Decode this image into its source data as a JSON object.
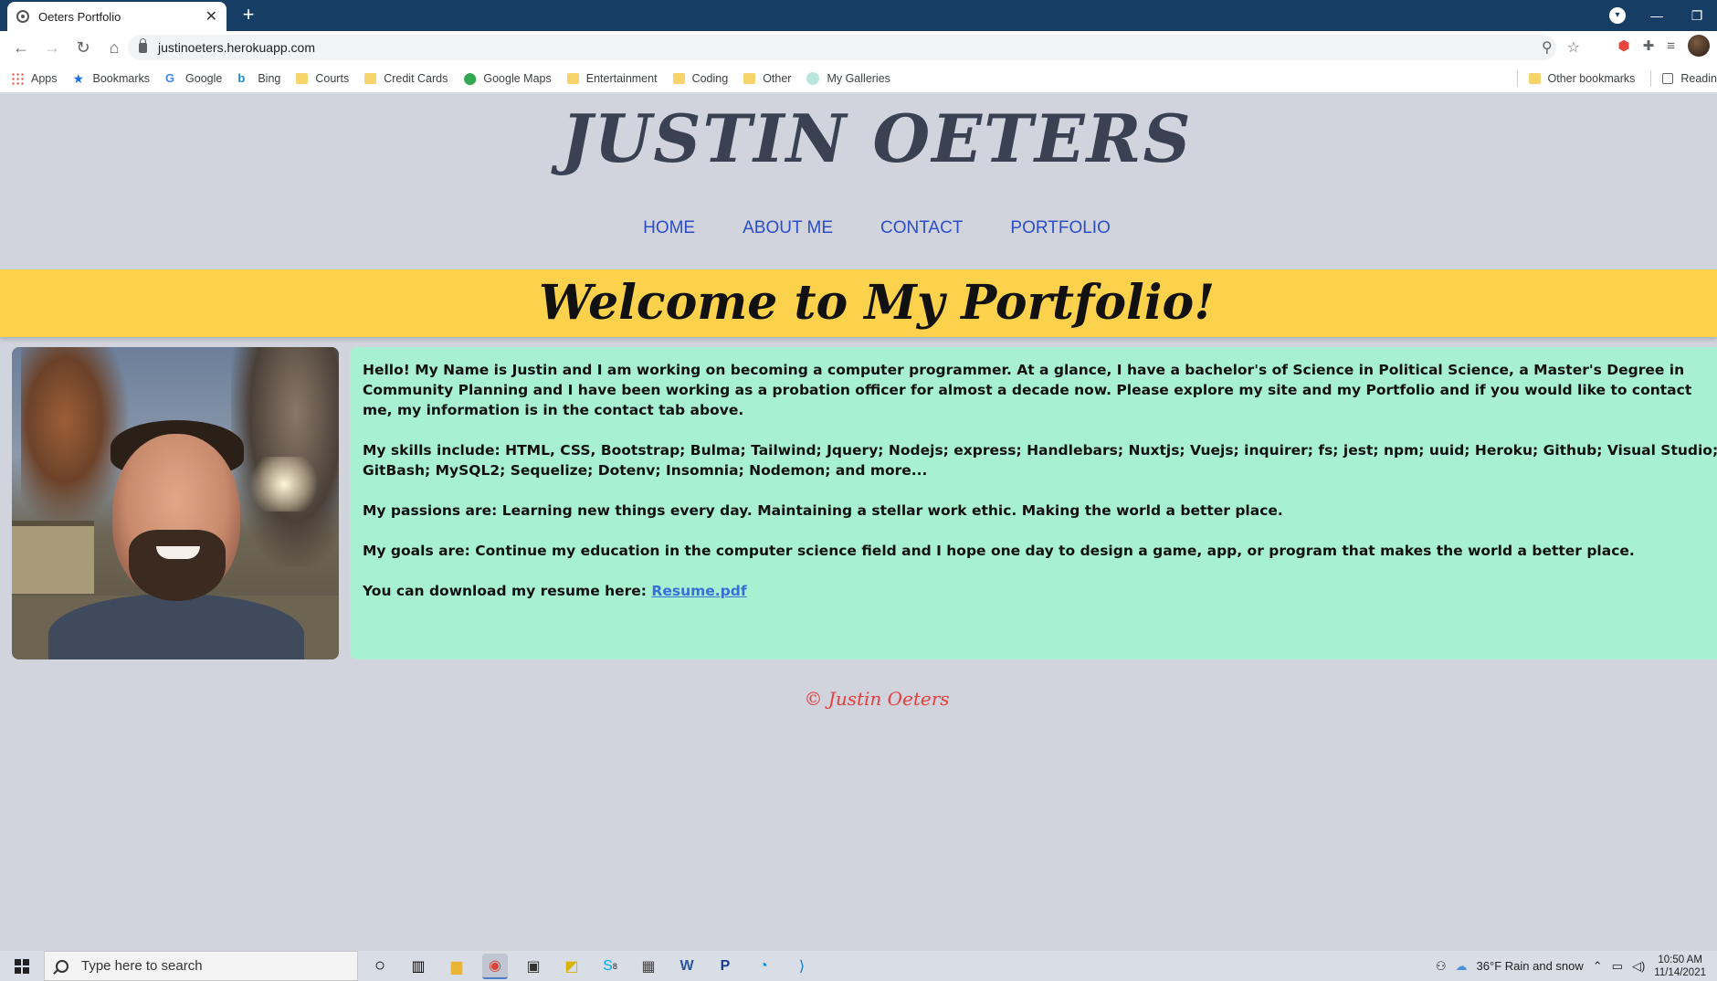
{
  "browser": {
    "tab_title": "Oeters Portfolio",
    "tab_close": "✕",
    "new_tab": "+",
    "url": "justinoeters.herokuapp.com"
  },
  "bookmarks": [
    {
      "label": "Apps",
      "icon": "apps-grid-icon"
    },
    {
      "label": "Bookmarks",
      "icon": "star-icon"
    },
    {
      "label": "Google",
      "icon": "google-icon"
    },
    {
      "label": "Bing",
      "icon": "bing-icon"
    },
    {
      "label": "Courts",
      "icon": "folder-icon"
    },
    {
      "label": "Credit Cards",
      "icon": "folder-icon"
    },
    {
      "label": "Google Maps",
      "icon": "maps-pin-icon"
    },
    {
      "label": "Entertainment",
      "icon": "folder-icon"
    },
    {
      "label": "Coding",
      "icon": "folder-icon"
    },
    {
      "label": "Other",
      "icon": "folder-icon"
    },
    {
      "label": "My Galleries",
      "icon": "galleries-icon"
    }
  ],
  "bookmarks_right": {
    "other": "Other bookmarks",
    "reading": "Readin"
  },
  "site": {
    "title": "JUSTIN OETERS",
    "nav": [
      "HOME",
      "ABOUT ME",
      "CONTACT",
      "PORTFOLIO"
    ],
    "welcome": "Welcome to My Portfolio!",
    "paragraphs": {
      "intro": "Hello! My Name is Justin and I am working on becoming a computer programmer. At a glance, I have a bachelor's of Science in Political Science, a Master's Degree in Community Planning and I have been working as a probation officer for almost a decade now. Please explore my site and my Portfolio and if you would like to contact me, my information is in the contact tab above.",
      "skills": "My skills include: HTML, CSS, Bootstrap; Bulma; Tailwind; Jquery; Nodejs; express; Handlebars; Nuxtjs; Vuejs; inquirer; fs; jest; npm; uuid; Heroku; Github; Visual Studio; GitBash; MySQL2; Sequelize; Dotenv; Insomnia; Nodemon; and more...",
      "passions": "My passions are: Learning new things every day. Maintaining a stellar work ethic. Making the world a better place.",
      "goals": "My goals are: Continue my education in the computer science field and I hope one day to design a game, app, or program that makes the world a better place.",
      "resume_prefix": "You can download my resume here: ",
      "resume_link": "Resume.pdf"
    },
    "footer": "© Justin Oeters"
  },
  "taskbar": {
    "search_placeholder": "Type here to search",
    "skype_badge": "8",
    "weather": "36°F  Rain and snow",
    "time": "10:50 AM",
    "date": "11/14/2021"
  }
}
